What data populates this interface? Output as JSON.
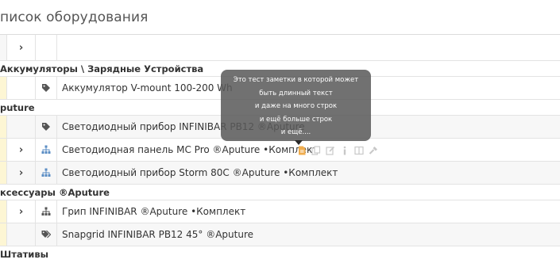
{
  "page": {
    "title": "писок оборудования"
  },
  "table": {
    "header": {
      "expand_icon": "chevron-right-icon"
    },
    "rows": [
      {
        "kind": "group",
        "label": "Аккумуляторы \\ Зарядные Устройства"
      },
      {
        "kind": "item",
        "name": "Аккумулятор V-mount 100-200 Wh",
        "icon": "tag-icon",
        "expand": false
      },
      {
        "kind": "group",
        "label": "puture"
      },
      {
        "kind": "item",
        "name": "Светодиодный прибор INFINIBAR PB12 ®Aputure",
        "icon": "tag-icon",
        "expand": false
      },
      {
        "kind": "item",
        "name": "Светодиодная панель MC Pro ®Aputure •Комплект",
        "icon": "sitemap-icon",
        "expand": true
      },
      {
        "kind": "item",
        "name": "Светодиодный прибор Storm 80C ®Aputure •Комплект",
        "icon": "sitemap-icon",
        "expand": true
      },
      {
        "kind": "group",
        "label": "ксессуары ®Aputure"
      },
      {
        "kind": "item",
        "name": "Грип INFINIBAR ®Aputure •Комплект",
        "icon": "sitemap-icon",
        "expand": true
      },
      {
        "kind": "item",
        "name": "Snapgrid INFINIBAR PB12 45° ®Aputure",
        "icon": "tags-icon",
        "expand": false
      },
      {
        "kind": "group",
        "label": "Штативы"
      }
    ]
  },
  "tooltip": {
    "lines": [
      "Это тест заметки в которой может",
      "быть длинный текст",
      "и даже на много строк",
      "и ещё больше строк",
      "и ещё...."
    ]
  },
  "row_actions": [
    "note-icon",
    "copy-icon",
    "edit-icon",
    "info-icon",
    "columns-icon",
    "wrench-icon"
  ],
  "colors": {
    "note_icon": "#f0ad4e",
    "icon_blue": "#5b8ec4",
    "icon_dark": "#555555",
    "muted_action": "#c8c8c8",
    "first_col_highlight": "#fdf6d4"
  }
}
